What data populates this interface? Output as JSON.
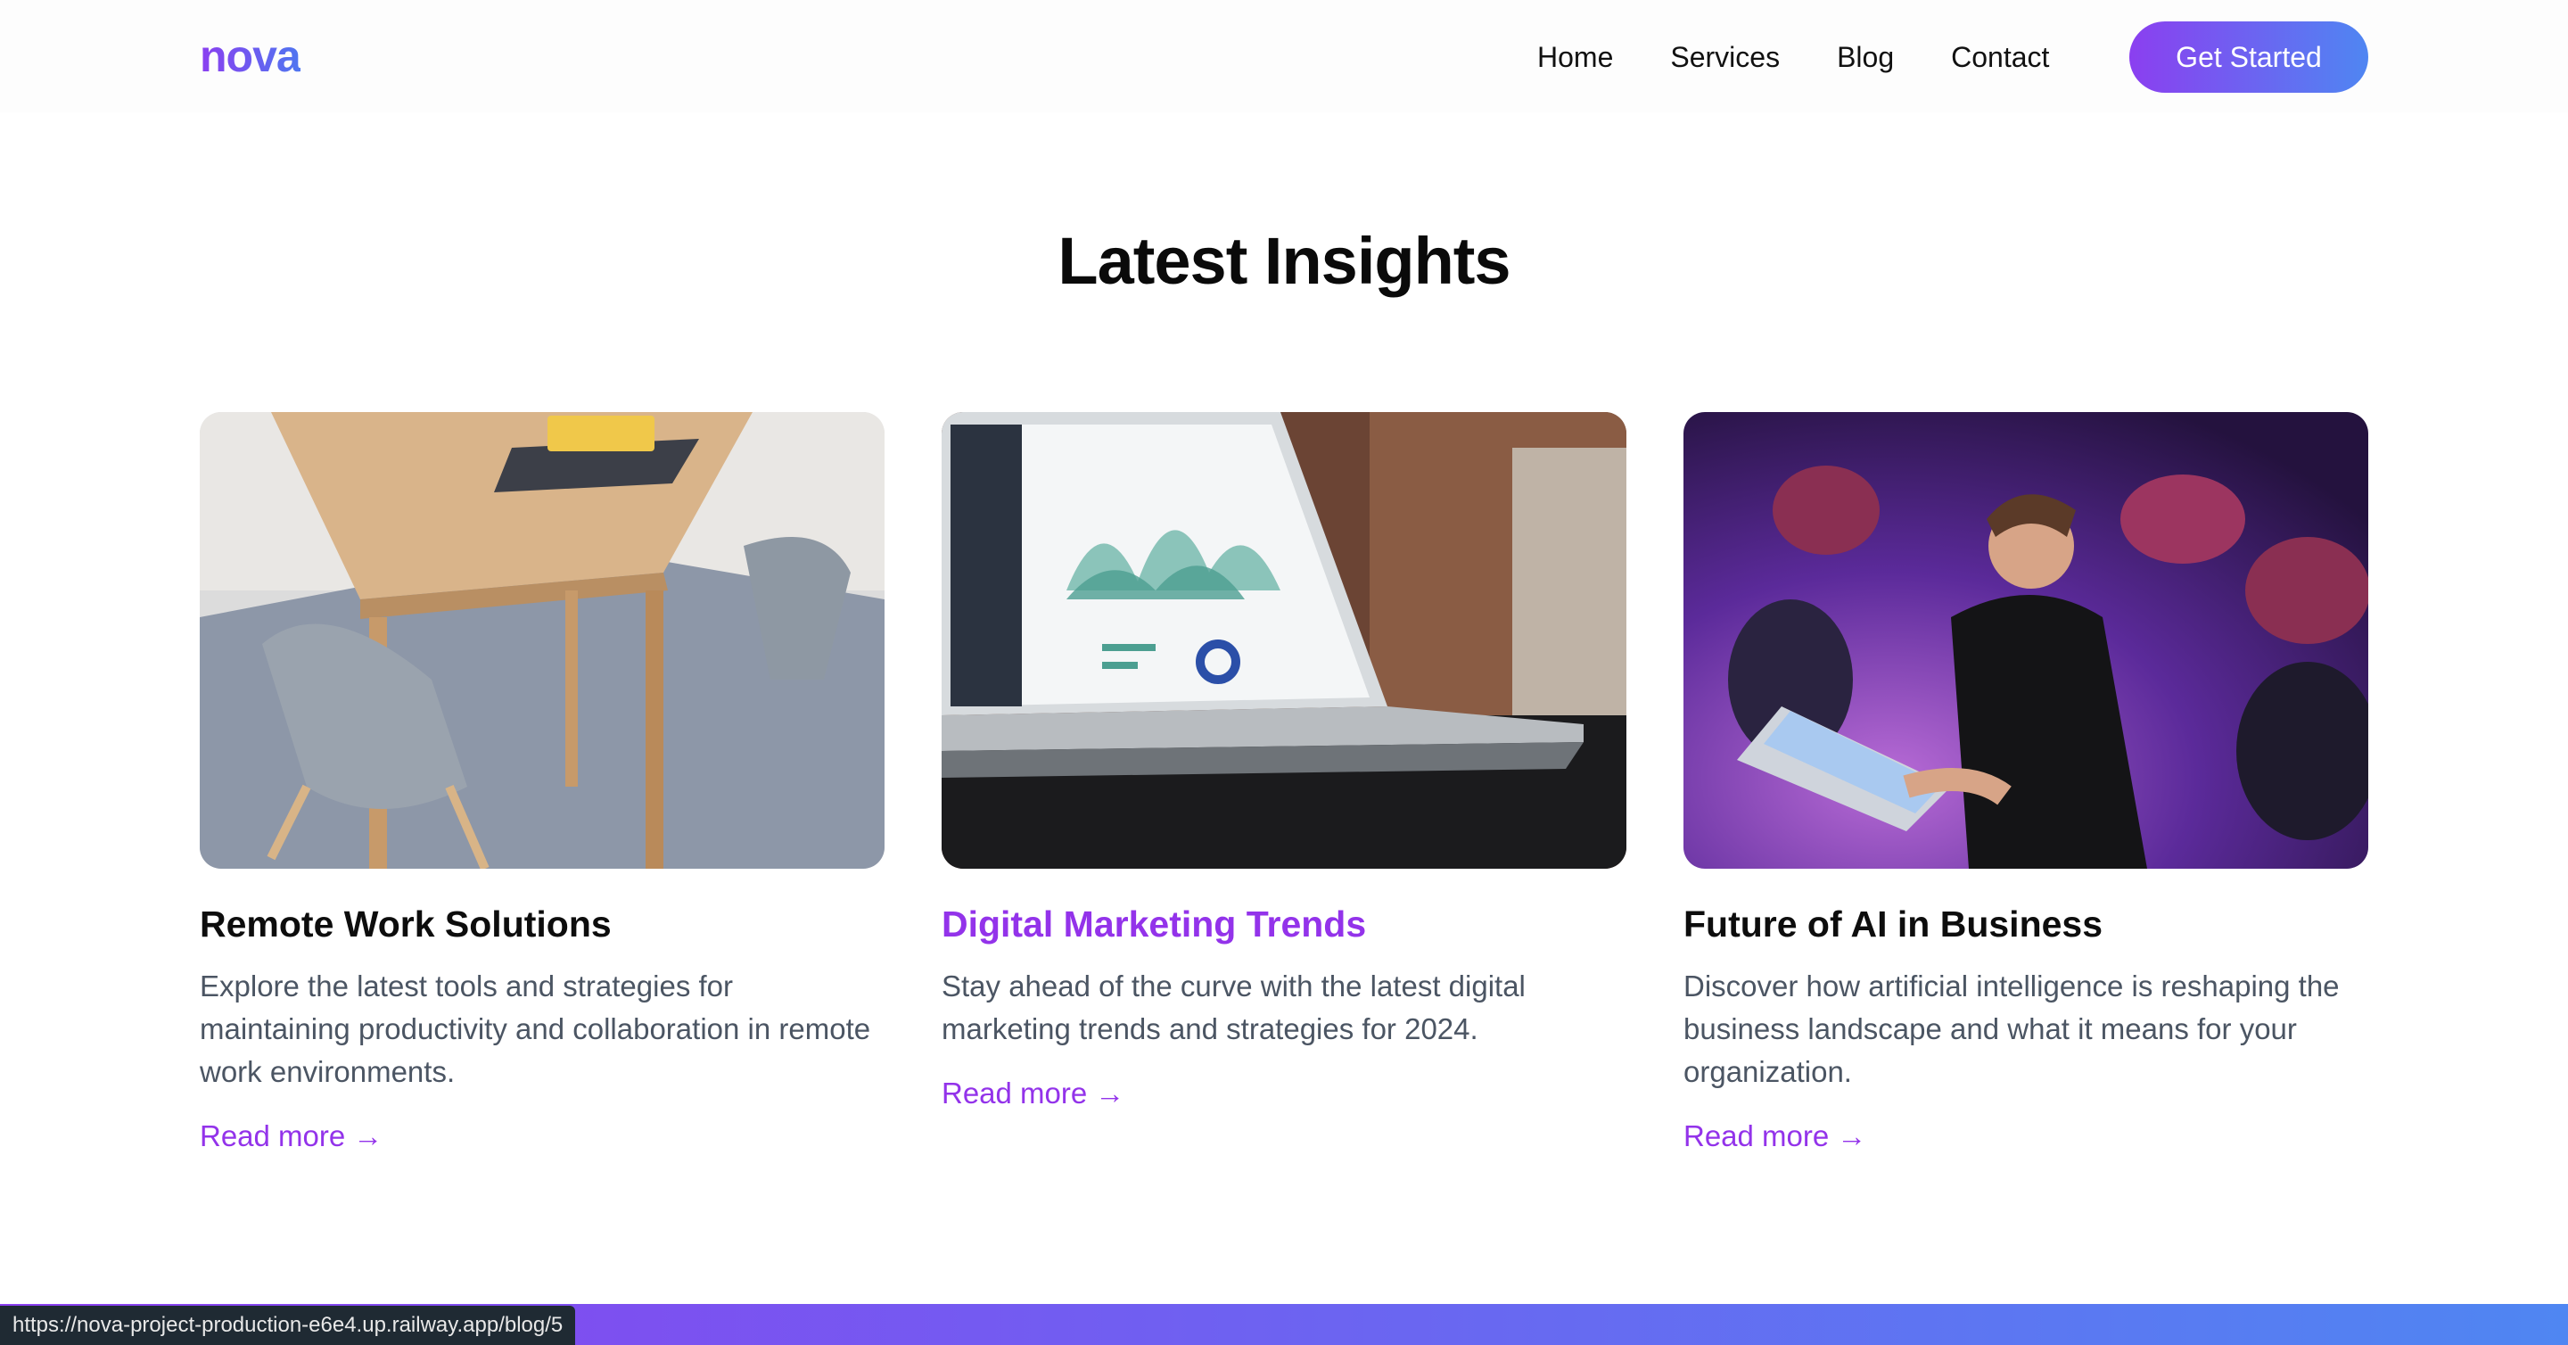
{
  "header": {
    "logo": "nova",
    "nav": [
      "Home",
      "Services",
      "Blog",
      "Contact"
    ],
    "cta_label": "Get Started"
  },
  "section": {
    "title": "Latest Insights"
  },
  "posts": [
    {
      "title": "Remote Work Solutions",
      "description": "Explore the latest tools and strategies for maintaining productivity and collaboration in remote work environments.",
      "read_more": "Read more →",
      "image": "desk-with-chair-and-tablet-photo"
    },
    {
      "title": "Digital Marketing Trends",
      "description": "Stay ahead of the curve with the latest digital marketing trends and strategies for 2024.",
      "read_more": "Read more →",
      "image": "laptop-analytics-dashboard-photo"
    },
    {
      "title": "Future of AI in Business",
      "description": "Discover how artificial intelligence is reshaping the business landscape and what it means for your organization.",
      "read_more": "Read more →",
      "image": "developer-at-hackathon-photo"
    }
  ],
  "status_bar": {
    "url": "https://nova-project-production-e6e4.up.railway.app/blog/5"
  },
  "colors": {
    "accent": "#9333ea",
    "gradient_start": "#8b3ff0",
    "gradient_end": "#4f86f2",
    "body_text": "#4b5563"
  }
}
